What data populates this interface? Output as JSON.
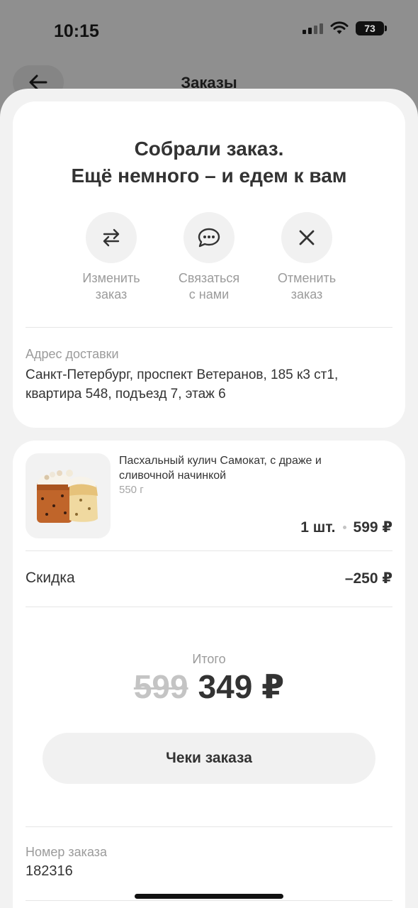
{
  "status_bar": {
    "time": "10:15",
    "battery": "73"
  },
  "background_page": {
    "title": "Заказы"
  },
  "order_status": {
    "headline_line1": "Собрали заказ.",
    "headline_line2": "Ещё немного – и едем к вам"
  },
  "actions": [
    {
      "label": "Изменить\nзаказ",
      "icon": "swap-arrows-icon"
    },
    {
      "label": "Связаться\nс нами",
      "icon": "chat-bubble-icon"
    },
    {
      "label": "Отменить\nзаказ",
      "icon": "close-icon"
    }
  ],
  "delivery": {
    "label": "Адрес доставки",
    "address": "Санкт-Петербург, проспект Ветеранов, 185 к3 ст1, квартира 548, подъезд 7, этаж 6"
  },
  "item": {
    "name": "Пасхальный кулич Самокат, с драже и сливочной начинкой",
    "weight": "550 г",
    "quantity": "1 шт.",
    "price": "599 ₽"
  },
  "discount": {
    "label": "Скидка",
    "value": "–250 ₽"
  },
  "total": {
    "label": "Итого",
    "old_price": "599",
    "new_price": "349 ₽"
  },
  "receipts_button": "Чеки заказа",
  "order_number": {
    "label": "Номер заказа",
    "value": "182316"
  },
  "colors": {
    "sheet_background": "#f2f2f2",
    "card": "#ffffff",
    "text_primary": "#333333",
    "text_secondary": "#9b9b9b",
    "dim_overlay": "#8f8f8f"
  }
}
